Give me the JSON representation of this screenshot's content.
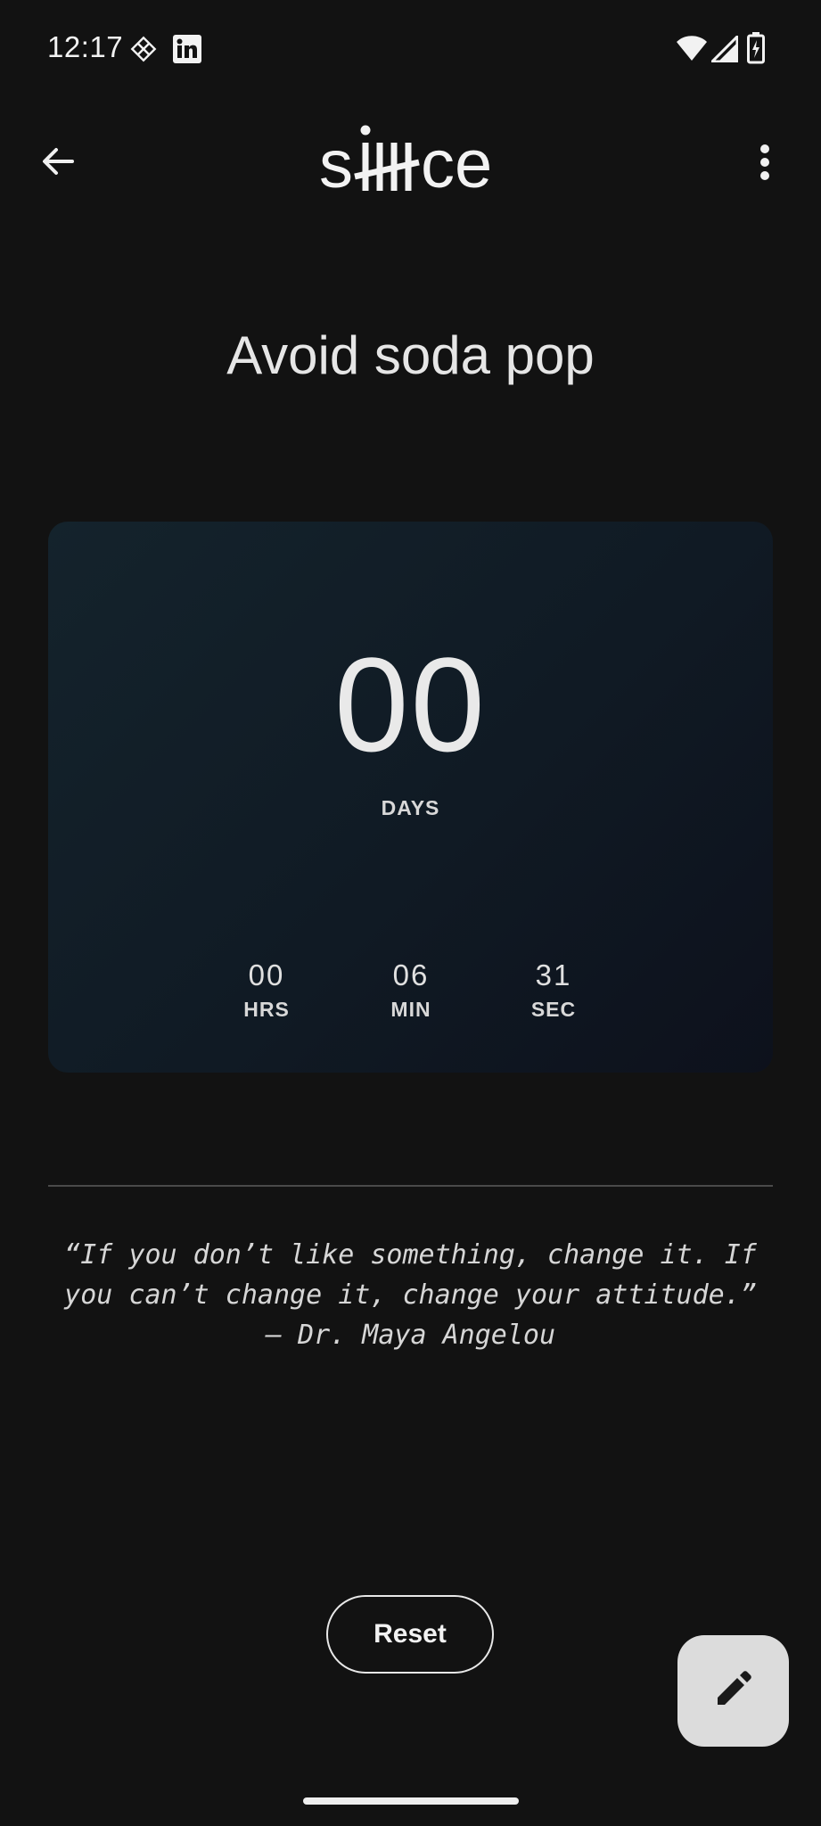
{
  "status_bar": {
    "time": "12:17",
    "icons": [
      "diamond-grid-icon",
      "linkedin-icon",
      "wifi-icon",
      "signal-icon",
      "battery-charging-icon"
    ]
  },
  "app_bar": {
    "logo_text": "siiiice",
    "back_icon": "arrow-back-icon",
    "menu_icon": "more-vert-icon"
  },
  "goal": {
    "title": "Avoid soda pop"
  },
  "timer": {
    "days_value": "00",
    "days_label": "DAYS",
    "hours_value": "00",
    "hours_label": "HRS",
    "minutes_value": "06",
    "minutes_label": "MIN",
    "seconds_value": "31",
    "seconds_label": "SEC"
  },
  "quote": {
    "line1": "“If you don’t like something, change it. If",
    "line2": "you can’t change it, change your attitude.”",
    "attribution": "— Dr. Maya Angelou"
  },
  "actions": {
    "reset_label": "Reset",
    "edit_icon": "pencil-icon"
  },
  "colors": {
    "background": "#121212",
    "card_start": "#14232c",
    "card_end": "#0d111c",
    "fab": "#dcdcdc"
  }
}
